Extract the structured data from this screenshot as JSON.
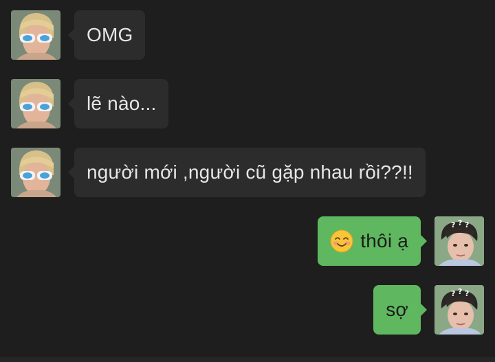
{
  "conversation": {
    "messages": [
      {
        "side": "incoming",
        "text": "OMG"
      },
      {
        "side": "incoming",
        "text": "lẽ nào..."
      },
      {
        "side": "incoming",
        "text": "người mới ,người cũ gặp nhau rồi??!!"
      },
      {
        "side": "outgoing",
        "text": "thôi ạ",
        "emoji": "smiling-face-icon"
      },
      {
        "side": "outgoing",
        "text": "sợ"
      }
    ]
  },
  "colors": {
    "background": "#1e1e1e",
    "incoming_bubble": "#2c2c2c",
    "outgoing_bubble": "#5fb85f"
  }
}
